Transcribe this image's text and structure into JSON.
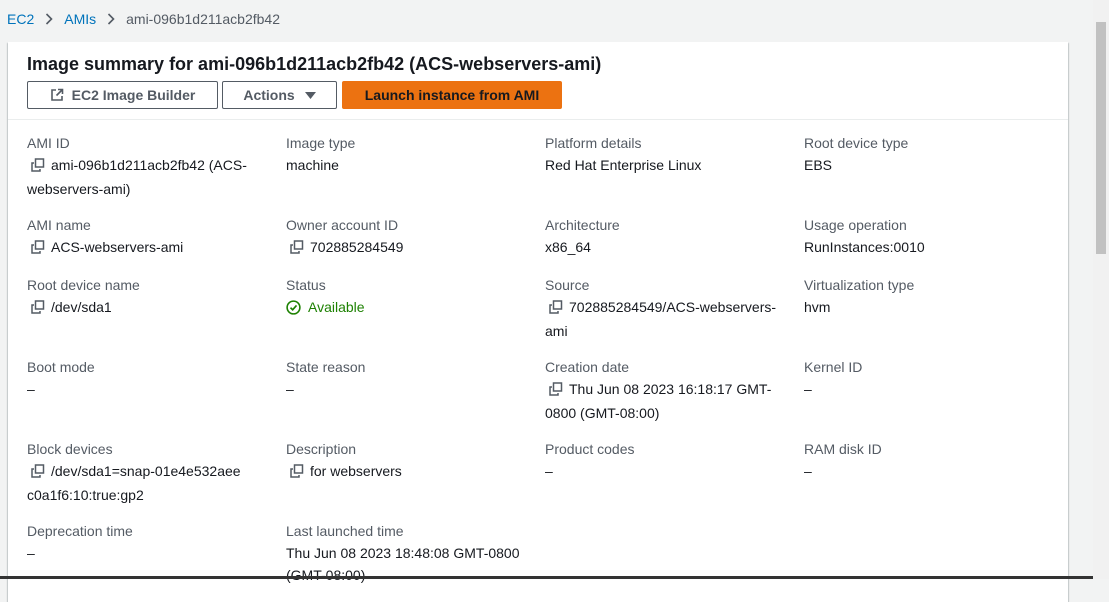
{
  "breadcrumb": {
    "items": [
      "EC2",
      "AMIs"
    ],
    "current": "ami-096b1d211acb2fb42"
  },
  "header": {
    "title": "Image summary for ami-096b1d211acb2fb42 (ACS-webservers-ami)",
    "buttons": {
      "image_builder": "EC2 Image Builder",
      "actions": "Actions",
      "launch": "Launch instance from AMI"
    }
  },
  "fields": {
    "ami_id": {
      "label": "AMI ID",
      "value": "ami-096b1d211acb2fb42 (ACS-webservers-ami)"
    },
    "image_type": {
      "label": "Image type",
      "value": "machine"
    },
    "platform_details": {
      "label": "Platform details",
      "value": "Red Hat Enterprise Linux"
    },
    "root_device_type": {
      "label": "Root device type",
      "value": "EBS"
    },
    "ami_name": {
      "label": "AMI name",
      "value": "ACS-webservers-ami"
    },
    "owner_account_id": {
      "label": "Owner account ID",
      "value": "702885284549"
    },
    "architecture": {
      "label": "Architecture",
      "value": "x86_64"
    },
    "usage_operation": {
      "label": "Usage operation",
      "value": "RunInstances:0010"
    },
    "root_device_name": {
      "label": "Root device name",
      "value": "/dev/sda1"
    },
    "status": {
      "label": "Status",
      "value": "Available"
    },
    "source": {
      "label": "Source",
      "value": "702885284549/ACS-webservers-ami"
    },
    "virtualization_type": {
      "label": "Virtualization type",
      "value": "hvm"
    },
    "boot_mode": {
      "label": "Boot mode",
      "value": "–"
    },
    "state_reason": {
      "label": "State reason",
      "value": "–"
    },
    "creation_date": {
      "label": "Creation date",
      "value": "Thu Jun 08 2023 16:18:17 GMT-0800 (GMT-08:00)"
    },
    "kernel_id": {
      "label": "Kernel ID",
      "value": "–"
    },
    "block_devices": {
      "label": "Block devices",
      "value": "/dev/sda1=snap-01e4e532aeec0a1f6:10:true:gp2"
    },
    "description": {
      "label": "Description",
      "value": "for webservers"
    },
    "product_codes": {
      "label": "Product codes",
      "value": "–"
    },
    "ram_disk_id": {
      "label": "RAM disk ID",
      "value": "–"
    },
    "deprecation_time": {
      "label": "Deprecation time",
      "value": "–"
    },
    "last_launched_time": {
      "label": "Last launched time",
      "value": "Thu Jun 08 2023 18:48:08 GMT-0800 (GMT-08:00)"
    }
  },
  "icons": {
    "copy": "copy-icon",
    "status": "check-circle-icon",
    "external": "external-link-icon",
    "caret": "caret-down-icon"
  },
  "colors": {
    "link": "#0073bb",
    "primary_button": "#ec7211",
    "status_available": "#1d8102"
  }
}
